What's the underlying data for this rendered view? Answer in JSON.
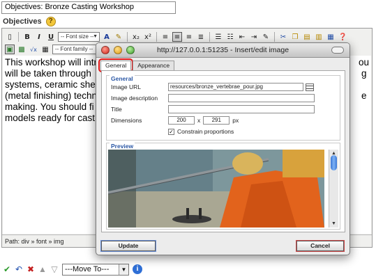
{
  "editor": {
    "title_value": "Objectives: Bronze Casting Workshop",
    "section_label": "Objectives",
    "toolbar1": {
      "font_size_label": "-- Font size --",
      "buttons": [
        "B",
        "I",
        "U"
      ]
    },
    "toolbar2": {
      "font_family_label": "-- Font family --"
    },
    "content_lines": [
      "This workshop will intr",
      "will be taken through",
      "systems, ceramic shel",
      "(metal finishing) techn",
      "making. You should fi",
      "models ready for cast"
    ],
    "content_right_fragments": [
      "ou",
      "g",
      "",
      "e",
      "",
      ""
    ],
    "path": "Path: div » font » img",
    "move_to_label": "---Move To---"
  },
  "dialog": {
    "title": "http://127.0.0.1:51235 - Insert/edit image",
    "tabs": [
      {
        "label": "General",
        "active": true
      },
      {
        "label": "Appearance",
        "active": false
      }
    ],
    "general_legend": "General",
    "fields": {
      "image_url_label": "Image URL",
      "image_url_value": "resources/bronze_vertebrae_pour.jpg",
      "image_description_label": "Image description",
      "image_description_value": "",
      "title_label": "Title",
      "title_value": "",
      "dimensions_label": "Dimensions",
      "width_value": "200",
      "times_sign": "x",
      "height_value": "291",
      "unit": "px",
      "constrain_label": "Constrain proportions",
      "constrain_checked": true
    },
    "preview_legend": "Preview",
    "update_label": "Update",
    "cancel_label": "Cancel"
  },
  "colors": {
    "legend_blue": "#2d59a6",
    "active_tab_outline": "#e01414",
    "scroll_thumb": "#3a78d6"
  }
}
